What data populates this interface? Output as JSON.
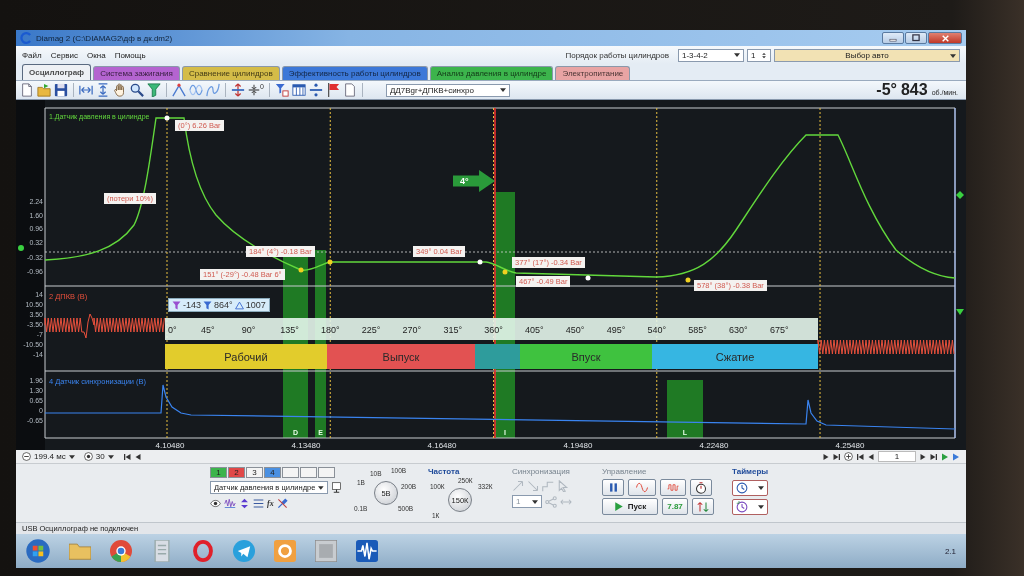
{
  "window": {
    "title": "Diamag 2 (C:\\DIAMAG2\\дф в дк.dm2)"
  },
  "menu": [
    "Файл",
    "Сервис",
    "Окна",
    "Помощь"
  ],
  "cylinder_order": {
    "label": "Порядок работы цилиндров",
    "value": "1-3-4-2",
    "cylinder": "1"
  },
  "car_select": {
    "value": "Выбор авто"
  },
  "tabs": [
    {
      "label": "Осциллограф",
      "selected": true,
      "color": "#eef1f5"
    },
    {
      "label": "Система зажигания",
      "selected": false,
      "color": "#b464d0"
    },
    {
      "label": "Сравнение цилиндров",
      "selected": false,
      "color": "#d4bc48"
    },
    {
      "label": "Эффективность работы цилиндров",
      "selected": false,
      "color": "#3c78d8"
    },
    {
      "label": "Анализ давления в цилиндре",
      "selected": false,
      "color": "#3cb44c"
    },
    {
      "label": "Электропитание",
      "selected": false,
      "color": "#e8a4a4"
    }
  ],
  "toolbar": {
    "offset_label": "0",
    "preset": "ДД7Вgr+ДПКВ+синхро",
    "angle": "-5°",
    "rpm": "843",
    "rpm_unit": "об./мин."
  },
  "oscillogram": {
    "channels": [
      {
        "name": "1.Датчик давления в цилиндре",
        "color": "#62d83c",
        "y_ticks": [
          "2.24",
          "1.60",
          "0.96",
          "0.32",
          "-0.32",
          "-0.96"
        ]
      },
      {
        "name": "2 ДПКВ (В)",
        "color": "#e8503c",
        "y_ticks": [
          "14",
          "10.50",
          "3.50",
          "-3.50",
          "-7",
          "-10.50",
          "-14"
        ]
      },
      {
        "name": "4 Датчик синхронизации (В)",
        "color": "#3a84f0",
        "y_ticks": [
          "1.96",
          "1.30",
          "0.65",
          "0",
          "-0.65"
        ]
      }
    ],
    "readouts": [
      "(0°) 6.26 Bar",
      "(потери 10%)",
      "184° (4°) -0.18 Bar",
      "151° (-29°) -0.48 Bar 6°",
      "349° 0.04 Bar",
      "377° (17°) -0.34 Bar",
      "467° -0.49 Bar",
      "578° (38°) -0.38 Bar"
    ],
    "angle_arrow": "4°",
    "cursors": {
      "start": "-143",
      "end": "864°",
      "delta": "1007"
    },
    "degree_scale": [
      "0°",
      "45°",
      "90°",
      "135°",
      "180°",
      "225°",
      "270°",
      "315°",
      "360°",
      "405°",
      "450°",
      "495°",
      "540°",
      "585°",
      "630°",
      "675°"
    ],
    "phases": [
      {
        "label": "Рабочий",
        "color": "#e2cc2c"
      },
      {
        "label": "Выпуск",
        "color": "#e25252"
      },
      {
        "color": "#2e9c9c"
      },
      {
        "label": "Впуск",
        "color": "#3fc23f"
      },
      {
        "label": "Сжатие",
        "color": "#36b6e2"
      }
    ],
    "zones": [
      "D",
      "E",
      "I",
      "L"
    ],
    "time_labels": [
      "4.10480",
      "4.13480",
      "4.16480",
      "4.19480",
      "4.22480",
      "4.25480"
    ]
  },
  "navigation": {
    "time_scale": "199.4 мс",
    "averaging": "30",
    "frame": "1"
  },
  "acquisition": {
    "channel_buttons": [
      {
        "label": "1",
        "color": "#3cb44c"
      },
      {
        "label": "2",
        "color": "#e04848"
      },
      {
        "label": "3",
        "color": "#f4f4f4"
      },
      {
        "label": "4",
        "color": "#4a90e2"
      },
      {
        "color": "#f4f4f4"
      },
      {
        "color": "#f4f4f4"
      },
      {
        "color": "#f4f4f4"
      }
    ],
    "sensor": "Датчик давления в цилиндре",
    "formula": "fx",
    "amplitude": {
      "value": "5В",
      "scale": [
        "10В",
        "100В",
        "1В",
        "200В",
        "0.1В",
        "500В"
      ]
    },
    "frequency": {
      "title": "Частота",
      "value": "150К",
      "scale": [
        "250К",
        "100К",
        "332К",
        "1К"
      ]
    },
    "sync": {
      "title": "Синхронизация",
      "disabled": true,
      "channel": "1"
    },
    "control": {
      "title": "Управление",
      "start": "Пуск",
      "readout": "7.87"
    },
    "timers": {
      "title": "Таймеры"
    }
  },
  "status_bar": "USB Осциллограф не подключен",
  "taskbar": {
    "tray": "2.1"
  }
}
